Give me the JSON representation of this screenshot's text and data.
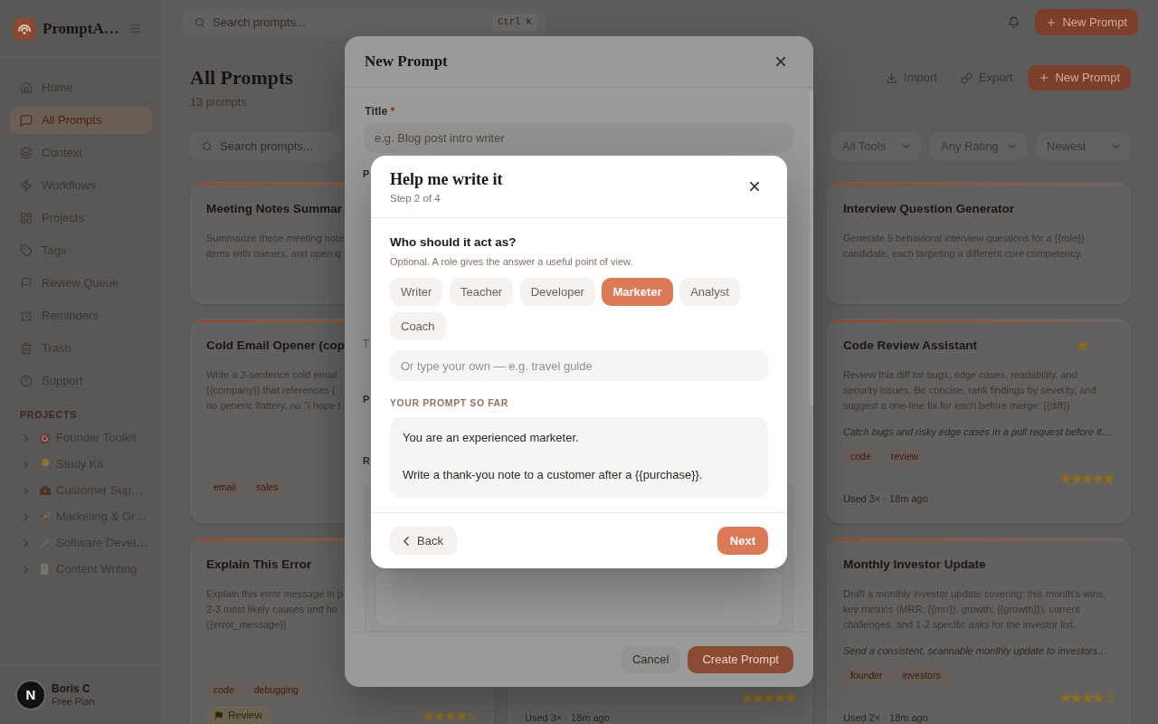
{
  "sidebar": {
    "app_name": "PromptA…",
    "nav": [
      {
        "label": "Home",
        "selected": false
      },
      {
        "label": "All Prompts",
        "selected": true
      },
      {
        "label": "Context",
        "selected": false
      },
      {
        "label": "Workflows",
        "selected": false
      },
      {
        "label": "Projects",
        "selected": false
      },
      {
        "label": "Tags",
        "selected": false
      },
      {
        "label": "Review Queue",
        "selected": false
      },
      {
        "label": "Reminders",
        "selected": false
      },
      {
        "label": "Trash",
        "selected": false
      },
      {
        "label": "Support",
        "selected": false
      }
    ],
    "projects_heading": "PROJECTS",
    "projects": [
      {
        "name": "Founder Toolkit",
        "expanded": false
      },
      {
        "name": "Study Kit",
        "expanded": false
      },
      {
        "name": "Customer Sup…",
        "expanded": false
      },
      {
        "name": "Marketing & Gr…",
        "expanded": false
      },
      {
        "name": "Software Devel…",
        "expanded": false
      },
      {
        "name": "Content Writing",
        "expanded": false
      }
    ],
    "user": {
      "initial": "N",
      "name": "Boris C",
      "plan": "Free Plan"
    }
  },
  "topbar": {
    "search_placeholder": "Search prompts...",
    "shortcut": "Ctrl K",
    "new_button": "New Prompt"
  },
  "header": {
    "title": "All Prompts",
    "count": "13 prompts",
    "actions": [
      "Import",
      "Export"
    ],
    "new_button": "New Prompt"
  },
  "filters": {
    "search_placeholder": "Search prompts...",
    "dropdowns": [
      "All Tools",
      "Any Rating",
      "Newest"
    ]
  },
  "card_grid": {
    "rows": [
      {
        "left": {
          "title": "Meeting Notes Summar",
          "description_lines": [
            "Summarize these meeting note",
            "items with owners, and open q"
          ]
        },
        "right": {
          "title": "Interview Question Generator",
          "favorite": false,
          "description": "Generate 5 behavioral interview questions for a {{role}} candidate, each targeting a different core competency."
        }
      },
      {
        "left": {
          "title": "Cold Email Opener (cop",
          "description_lines": [
            "Write a 2-sentence cold email",
            "{{company}} that references {",
            "no generic flattery, no “I hope t"
          ],
          "tags": [
            "email",
            "sales"
          ]
        },
        "right": {
          "title": "Code Review Assistant",
          "favorite": true,
          "description": "Review this diff for bugs, edge cases, readability, and security issues. Be concise, rank findings by severity, and suggest a one-line fix for each before merge: {{diff}}",
          "summary": "Catch bugs and risky edge cases in a pull request before it…",
          "tags": [
            "code",
            "review"
          ],
          "stars": 5,
          "usage": "Used 3× · 18m ago"
        }
      },
      {
        "left": {
          "title": "Explain This Error",
          "description_lines": [
            "Explain this error message in p",
            "2-3 most likely causes and ho",
            "{{error_message}}"
          ],
          "tags": [
            "code",
            "debugging"
          ],
          "badge": "Review",
          "stars": 4
        },
        "middle": {
          "stars": 5,
          "usage": "Used 3× · 18m ago"
        },
        "right": {
          "title": "Monthly Investor Update",
          "favorite": false,
          "description": "Draft a monthly investor update covering: this month's wins, key metrics (MRR: {{mrr}}, growth: {{growth}}), current challenges, and 1-2 specific asks for the investor list.",
          "summary": "Send a consistent, scannable monthly update to investors…",
          "tags": [
            "founder",
            "investors"
          ],
          "stars": 4,
          "usage": "Used 2× · 18m ago"
        }
      }
    ]
  },
  "new_prompt_modal": {
    "title": "New Prompt",
    "title_field": {
      "label": "Title",
      "required_mark": "*",
      "placeholder": "e.g. Blog post intro writer"
    },
    "covered_labels": [
      {
        "text": "P",
        "kind": "label"
      },
      {
        "text": "T",
        "kind": "hint"
      },
      {
        "text": "P",
        "kind": "label"
      },
      {
        "text": "R",
        "kind": "label"
      }
    ],
    "buttons": [
      {
        "label": "Cancel",
        "kind": "secondary"
      },
      {
        "label": "Create Prompt",
        "kind": "primary"
      }
    ]
  },
  "helper_modal": {
    "title": "Help me write it",
    "step": "Step 2 of 4",
    "question": "Who should it act as?",
    "hint": "Optional. A role gives the answer a useful point of view.",
    "roles": [
      {
        "label": "Writer",
        "selected": false
      },
      {
        "label": "Teacher",
        "selected": false
      },
      {
        "label": "Developer",
        "selected": false
      },
      {
        "label": "Marketer",
        "selected": true
      },
      {
        "label": "Analyst",
        "selected": false
      },
      {
        "label": "Coach",
        "selected": false
      }
    ],
    "custom_placeholder": "Or type your own — e.g. travel guide",
    "preview_heading": "YOUR PROMPT SO FAR",
    "preview_paragraphs": [
      "You are an experienced marketer.",
      "Write a thank-you note to a customer after a {{purchase}}."
    ],
    "back_button": "Back",
    "next_button": "Next"
  }
}
